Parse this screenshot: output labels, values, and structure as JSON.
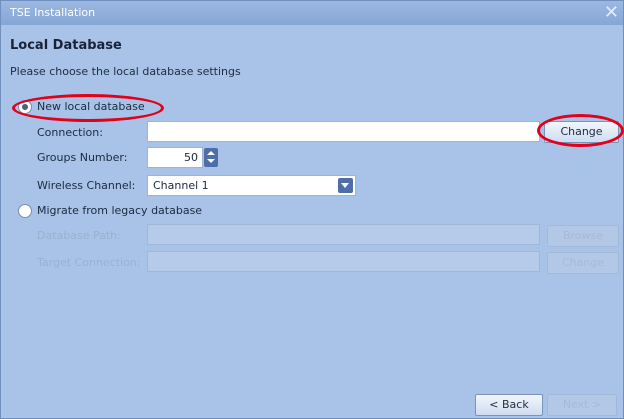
{
  "window": {
    "title": "TSE Installation",
    "close_glyph": "✕"
  },
  "page": {
    "heading": "Local Database",
    "description": "Please choose the local database settings"
  },
  "new_db": {
    "label": "New local database",
    "selected": true,
    "connection_label": "Connection:",
    "connection_value": "",
    "change_label": "Change",
    "groups_label": "Groups Number:",
    "groups_value": "50",
    "channel_label": "Wireless Channel:",
    "channel_value": "Channel 1"
  },
  "migrate": {
    "label": "Migrate from legacy database",
    "selected": false,
    "path_label": "Database Path:",
    "path_value": "",
    "browse_label": "Browse",
    "target_label": "Target Connection:",
    "target_value": "",
    "target_change_label": "Change"
  },
  "footer": {
    "back_label": "< Back",
    "next_label": "Next >"
  },
  "annotation_color": "#e3001b",
  "icons": {
    "close": "close-icon",
    "spinner": "spinner-icon",
    "dropdown": "chevron-down-icon"
  }
}
